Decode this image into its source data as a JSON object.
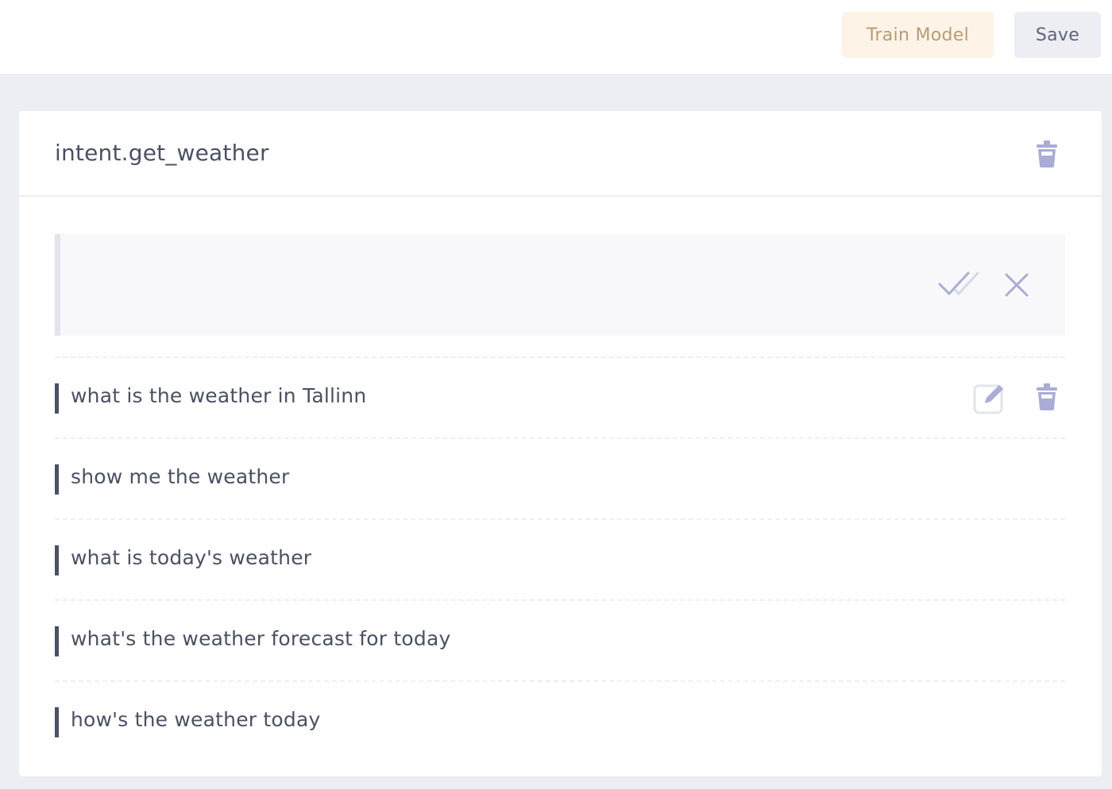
{
  "toolbar": {
    "train_label": "Train Model",
    "save_label": "Save"
  },
  "intent": {
    "title": "intent.get_weather",
    "editor_value": "",
    "examples": [
      "what is the weather in Tallinn",
      "show me the weather",
      "what is today's weather",
      "what's the weather forecast for today",
      "how's the weather today"
    ]
  },
  "icons": {
    "delete": "trash-icon",
    "confirm": "double-check-icon",
    "cancel": "close-icon",
    "edit": "pencil-square-icon"
  },
  "colors": {
    "background": "#eceef3",
    "train_bg": "#fdf4e7",
    "train_text": "#b89c73",
    "save_bg": "#eceef4",
    "text": "#4a5163",
    "icon": "#a9acd6"
  }
}
